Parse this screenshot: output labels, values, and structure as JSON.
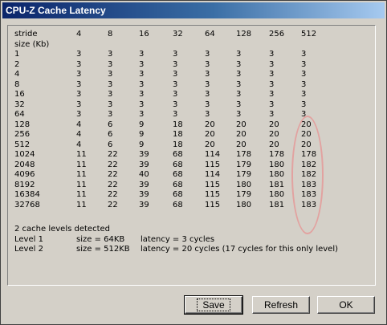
{
  "window": {
    "title": "CPU-Z Cache Latency"
  },
  "header": {
    "stride_label": "stride",
    "size_label": "size (Kb)",
    "strides": [
      "4",
      "8",
      "16",
      "32",
      "64",
      "128",
      "256",
      "512"
    ]
  },
  "rows": [
    {
      "size": "1",
      "values": [
        "3",
        "3",
        "3",
        "3",
        "3",
        "3",
        "3",
        "3"
      ]
    },
    {
      "size": "2",
      "values": [
        "3",
        "3",
        "3",
        "3",
        "3",
        "3",
        "3",
        "3"
      ]
    },
    {
      "size": "4",
      "values": [
        "3",
        "3",
        "3",
        "3",
        "3",
        "3",
        "3",
        "3"
      ]
    },
    {
      "size": "8",
      "values": [
        "3",
        "3",
        "3",
        "3",
        "3",
        "3",
        "3",
        "3"
      ]
    },
    {
      "size": "16",
      "values": [
        "3",
        "3",
        "3",
        "3",
        "3",
        "3",
        "3",
        "3"
      ]
    },
    {
      "size": "32",
      "values": [
        "3",
        "3",
        "3",
        "3",
        "3",
        "3",
        "3",
        "3"
      ]
    },
    {
      "size": "64",
      "values": [
        "3",
        "3",
        "3",
        "3",
        "3",
        "3",
        "3",
        "3"
      ]
    },
    {
      "size": "128",
      "values": [
        "4",
        "6",
        "9",
        "18",
        "20",
        "20",
        "20",
        "20"
      ]
    },
    {
      "size": "256",
      "values": [
        "4",
        "6",
        "9",
        "18",
        "20",
        "20",
        "20",
        "20"
      ]
    },
    {
      "size": "512",
      "values": [
        "4",
        "6",
        "9",
        "18",
        "20",
        "20",
        "20",
        "20"
      ]
    },
    {
      "size": "1024",
      "values": [
        "11",
        "22",
        "39",
        "68",
        "114",
        "178",
        "178",
        "178"
      ]
    },
    {
      "size": "2048",
      "values": [
        "11",
        "22",
        "39",
        "68",
        "115",
        "179",
        "180",
        "182"
      ]
    },
    {
      "size": "4096",
      "values": [
        "11",
        "22",
        "40",
        "68",
        "114",
        "179",
        "180",
        "182"
      ]
    },
    {
      "size": "8192",
      "values": [
        "11",
        "22",
        "39",
        "68",
        "115",
        "180",
        "181",
        "183"
      ]
    },
    {
      "size": "16384",
      "values": [
        "11",
        "22",
        "39",
        "68",
        "115",
        "179",
        "180",
        "183"
      ]
    },
    {
      "size": "32768",
      "values": [
        "11",
        "22",
        "39",
        "68",
        "115",
        "180",
        "181",
        "183"
      ]
    }
  ],
  "summary": {
    "detected": "2 cache levels detected",
    "levels": [
      {
        "name": "Level 1",
        "size": "size = 64KB",
        "latency": "latency = 3 cycles"
      },
      {
        "name": "Level 2",
        "size": "size = 512KB",
        "latency": "latency = 20 cycles (17 cycles for this only level)"
      }
    ]
  },
  "buttons": {
    "save": "Save",
    "refresh": "Refresh",
    "ok": "OK"
  },
  "colors": {
    "highlight_ellipse": "#e2a2a0",
    "titlebar_start": "#0a246a",
    "titlebar_end": "#a6caf0"
  }
}
